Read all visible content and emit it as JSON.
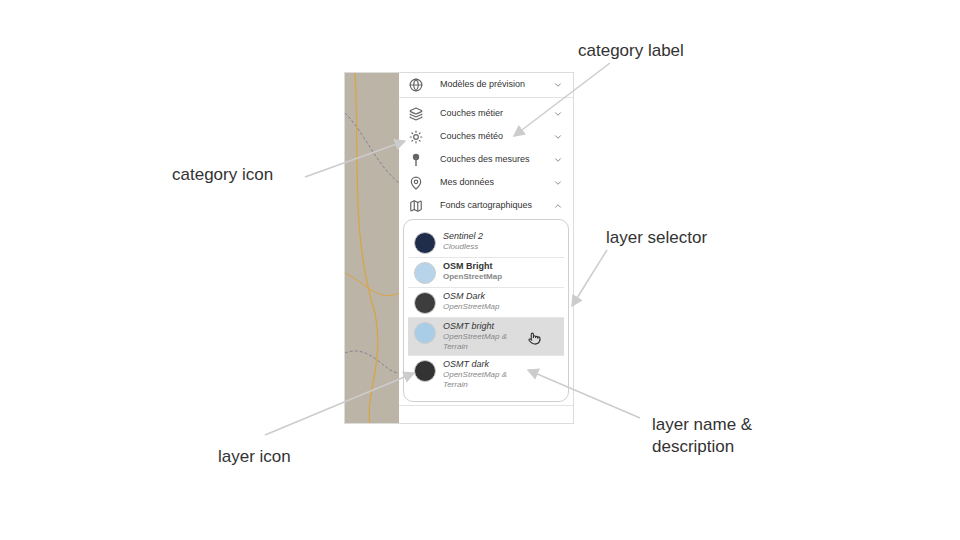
{
  "annotations": [
    {
      "text": "category label"
    },
    {
      "text": "category icon"
    },
    {
      "text": "layer selector"
    },
    {
      "text": "layer icon"
    },
    {
      "text": "layer name & description"
    }
  ],
  "categories": [
    {
      "label": "Modèles de prévision",
      "expanded": false
    },
    {
      "label": "Couches métier",
      "expanded": false
    },
    {
      "label": "Couches météo",
      "expanded": false
    },
    {
      "label": "Couches des mesures",
      "expanded": false
    },
    {
      "label": "Mes données",
      "expanded": false
    },
    {
      "label": "Fonds cartographiques",
      "expanded": true
    }
  ],
  "layers": [
    {
      "name": "Sentinel 2",
      "description": "Cloudless",
      "selected": false,
      "hovered": false,
      "color": "#1f2d4a"
    },
    {
      "name": "OSM Bright",
      "description": "OpenStreetMap",
      "selected": true,
      "hovered": false,
      "color": "#b8d4ea"
    },
    {
      "name": "OSM Dark",
      "description": "OpenStreetMap",
      "selected": false,
      "hovered": false,
      "color": "#3d3d3d"
    },
    {
      "name": "OSMT bright",
      "description": "OpenStreetMap & Terrain",
      "selected": false,
      "hovered": true,
      "color": "#a9cde6"
    },
    {
      "name": "OSMT dark",
      "description": "OpenStreetMap & Terrain",
      "selected": false,
      "hovered": false,
      "color": "#333333"
    }
  ]
}
